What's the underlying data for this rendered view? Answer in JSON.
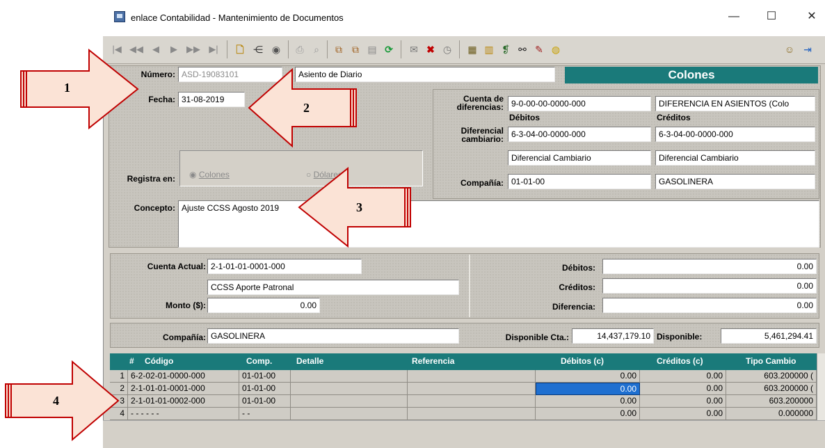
{
  "window": {
    "title": "enlace Contabilidad - Mantenimiento de Documentos",
    "minimize": "—",
    "maximize": "☐",
    "close": "✕"
  },
  "toolbar": {
    "nav": [
      "|◀",
      "◀◀",
      "◀",
      "▶",
      "▶▶",
      "▶|"
    ],
    "icons": [
      "new-document-icon",
      "tree-icon",
      "save-icon",
      "print-icon",
      "preview-icon",
      "copy-icon",
      "paste-icon",
      "clipboard-icon",
      "refresh-icon",
      "mail-icon",
      "delete-icon",
      "clock-icon",
      "calculator-icon",
      "chart-icon",
      "book-icon",
      "binoculars-icon",
      "pen-icon",
      "coin-icon",
      "user-icon",
      "exit-icon"
    ]
  },
  "form": {
    "numero_label": "Número:",
    "numero_value": "ASD-19083101",
    "tipo_value": "Asiento de Diario",
    "moneda_banner": "Colones",
    "fecha_label": "Fecha:",
    "fecha_value": "31-08-2019",
    "cuenta_dif_label1": "Cuenta de",
    "cuenta_dif_label2": "diferencias:",
    "cuenta_dif_value": "9-0-00-00-0000-000",
    "cuenta_dif_desc": "DIFERENCIA EN ASIENTOS (Colo",
    "debitos_hdr": "Débitos",
    "creditos_hdr": "Créditos",
    "dif_cambiario_label1": "Diferencial",
    "dif_cambiario_label2": "cambiario:",
    "dif_deb_value": "6-3-04-00-0000-000",
    "dif_cred_value": "6-3-04-00-0000-000",
    "dif_deb_desc": "Diferencial Cambiario",
    "dif_cred_desc": "Diferencial Cambiario",
    "registra_label": "Registra en:",
    "radio_colones": "Colones",
    "radio_dolares": "Dólares",
    "compania_label": "Compañía:",
    "compania_value": "01-01-00",
    "compania_desc": "GASOLINERA",
    "concepto_label": "Concepto:",
    "concepto_value": "Ajuste CCSS Agosto 2019"
  },
  "account": {
    "cuenta_actual_label": "Cuenta Actual:",
    "cuenta_actual_value": "2-1-01-01-0001-000",
    "cuenta_desc": "CCSS Aporte Patronal",
    "monto_label": "Monto ($):",
    "monto_value": "0.00",
    "debitos_label": "Débitos:",
    "debitos_value": "0.00",
    "creditos_label": "Créditos:",
    "creditos_value": "0.00",
    "diferencia_label": "Diferencia:",
    "diferencia_value": "0.00",
    "compania_label": "Compañía:",
    "compania_value": "GASOLINERA",
    "disp_cta_label": "Disponible Cta.:",
    "disp_cta_value": "14,437,179.10",
    "disponible_label": "Disponible:",
    "disponible_value": "5,461,294.41"
  },
  "grid": {
    "headers": [
      "#",
      "Código",
      "Comp.",
      "Detalle",
      "Referencia",
      "Débitos (c)",
      "Créditos (c)",
      "Tipo Cambio"
    ],
    "rows": [
      [
        "1",
        "6-2-02-01-0000-000",
        "01-01-00",
        "",
        "",
        "0.00",
        "0.00",
        "603.200000 ("
      ],
      [
        "2",
        "2-1-01-01-0001-000",
        "01-01-00",
        "",
        "",
        "0.00",
        "0.00",
        "603.200000 ("
      ],
      [
        "3",
        "2-1-01-01-0002-000",
        "01-01-00",
        "",
        "",
        "0.00",
        "0.00",
        "603.200000"
      ],
      [
        "4",
        "- - - - - -",
        "- -",
        "",
        "",
        "0.00",
        "0.00",
        "0.000000"
      ]
    ]
  },
  "callouts": [
    "1",
    "2",
    "3",
    "4"
  ],
  "colors": {
    "teal": "#1a7a7a",
    "arrow_fill": "#fbe3d6",
    "arrow_stroke": "#c00000"
  }
}
